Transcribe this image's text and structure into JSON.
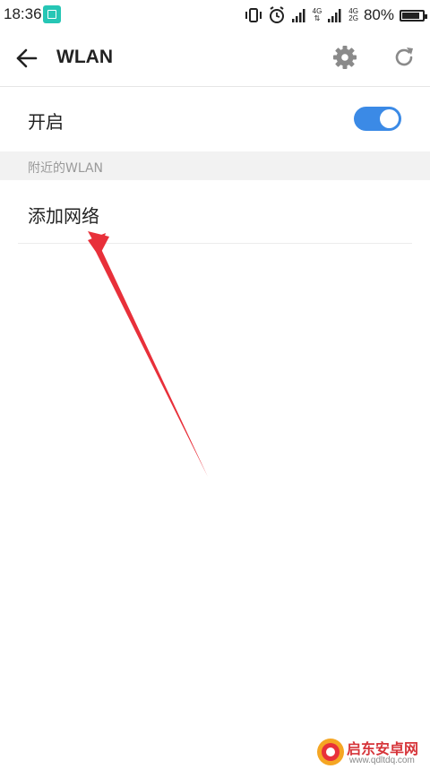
{
  "status_bar": {
    "time": "18:36",
    "net_top_1": "4G",
    "net_top_2": "4G",
    "net_bottom_2": "2G",
    "battery": "80%"
  },
  "toolbar": {
    "title": "WLAN",
    "icons": [
      "back-arrow-icon",
      "gear-icon",
      "refresh-icon"
    ]
  },
  "enable_row": {
    "label": "开启",
    "toggle_on": true,
    "accent_color": "#3b8ae6"
  },
  "section": {
    "header": "附近的WLAN"
  },
  "add_network": {
    "label": "添加网络"
  },
  "watermark": {
    "text": "启东安卓网",
    "url": "www.qdltdq.com"
  }
}
